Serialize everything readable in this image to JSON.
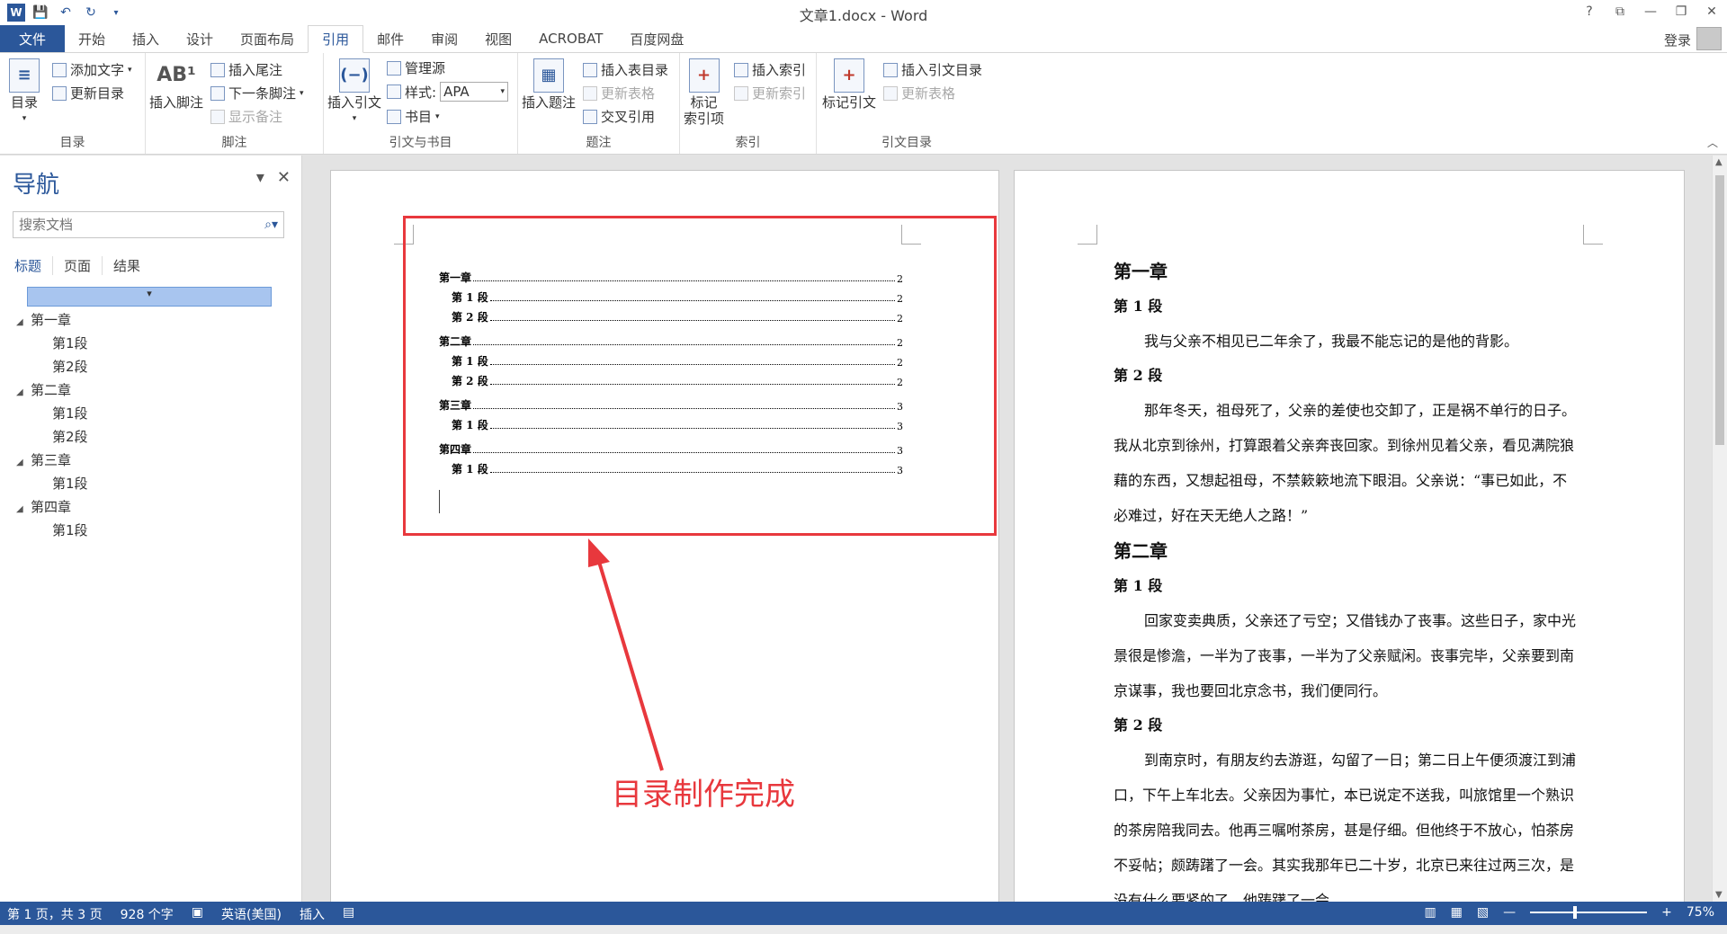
{
  "titlebar": {
    "title": "文章1.docx - Word",
    "help": "?",
    "restore": "⧉",
    "minimize": "—",
    "maximize": "❐",
    "close": "✕"
  },
  "tabs": {
    "file": "文件",
    "items": [
      "开始",
      "插入",
      "设计",
      "页面布局",
      "引用",
      "邮件",
      "审阅",
      "视图",
      "ACROBAT",
      "百度网盘"
    ],
    "active": "引用",
    "login": "登录"
  },
  "ribbon": {
    "toc_group": {
      "label": "目录",
      "toc_button": "目录",
      "add_text": "添加文字",
      "update_toc": "更新目录"
    },
    "footnote_group": {
      "label": "脚注",
      "insert_footnote": "插入脚注",
      "insert_endnote": "插入尾注",
      "next_footnote": "下一条脚注",
      "show_notes": "显示备注"
    },
    "citation_group": {
      "label": "引文与书目",
      "insert_citation": "插入引文",
      "manage_sources": "管理源",
      "style_label": "样式:",
      "style_value": "APA",
      "bibliography": "书目"
    },
    "caption_group": {
      "label": "题注",
      "insert_caption": "插入题注",
      "insert_table_of_figures": "插入表目录",
      "update_table": "更新表格",
      "cross_reference": "交叉引用"
    },
    "index_group": {
      "label": "索引",
      "mark_entry": "标记\n索引项",
      "insert_index": "插入索引",
      "update_index": "更新索引"
    },
    "authorities_group": {
      "label": "引文目录",
      "mark_citation": "标记引文",
      "insert_table_of_authorities": "插入引文目录",
      "update_table": "更新表格"
    }
  },
  "nav": {
    "title": "导航",
    "search_placeholder": "搜索文档",
    "tabs": [
      "标题",
      "页面",
      "结果"
    ],
    "tree": [
      {
        "heading": "第一章",
        "subs": [
          "第1段",
          "第2段"
        ]
      },
      {
        "heading": "第二章",
        "subs": [
          "第1段",
          "第2段"
        ]
      },
      {
        "heading": "第三章",
        "subs": [
          "第1段"
        ]
      },
      {
        "heading": "第四章",
        "subs": [
          "第1段"
        ]
      }
    ]
  },
  "toc": [
    {
      "text": "第一章",
      "page": "2",
      "level": 1
    },
    {
      "text": "第 1 段",
      "page": "2",
      "level": 2
    },
    {
      "text": "第 2 段",
      "page": "2",
      "level": 2
    },
    {
      "text": "第二章",
      "page": "2",
      "level": 1
    },
    {
      "text": "第 1 段",
      "page": "2",
      "level": 2
    },
    {
      "text": "第 2 段",
      "page": "2",
      "level": 2
    },
    {
      "text": "第三章",
      "page": "3",
      "level": 1
    },
    {
      "text": "第 1 段",
      "page": "3",
      "level": 2
    },
    {
      "text": "第四章",
      "page": "3",
      "level": 1
    },
    {
      "text": "第 1 段",
      "page": "3",
      "level": 2
    }
  ],
  "annotation": "目录制作完成",
  "page2": [
    {
      "type": "h1",
      "text": "第一章"
    },
    {
      "type": "h2",
      "text": "第 1 段"
    },
    {
      "type": "p",
      "text": "我与父亲不相见已二年余了，我最不能忘记的是他的背影。"
    },
    {
      "type": "h2",
      "text": "第 2 段"
    },
    {
      "type": "p",
      "text": "那年冬天，祖母死了，父亲的差使也交卸了，正是祸不单行的日子。我从北京到徐州，打算跟着父亲奔丧回家。到徐州见着父亲，看见满院狼藉的东西，又想起祖母，不禁簌簌地流下眼泪。父亲说：“事已如此，不必难过，好在天无绝人之路！”"
    },
    {
      "type": "h1",
      "text": "第二章"
    },
    {
      "type": "h2",
      "text": "第 1 段"
    },
    {
      "type": "p",
      "text": "回家变卖典质，父亲还了亏空；又借钱办了丧事。这些日子，家中光景很是惨澹，一半为了丧事，一半为了父亲赋闲。丧事完毕，父亲要到南京谋事，我也要回北京念书，我们便同行。"
    },
    {
      "type": "h2",
      "text": "第 2 段"
    },
    {
      "type": "p",
      "text": "到南京时，有朋友约去游逛，勾留了一日；第二日上午便须渡江到浦口，下午上车北去。父亲因为事忙，本已说定不送我，叫旅馆里一个熟识的茶房陪我同去。他再三嘱咐茶房，甚是仔细。但他终于不放心，怕茶房不妥帖；颇踌躇了一会。其实我那年已二十岁，北京已来往过两三次，是没有什么要紧的了。他踌躇了一会，"
    }
  ],
  "status": {
    "page": "第 1 页，共 3 页",
    "words": "928 个字",
    "language": "英语(美国)",
    "mode": "插入",
    "zoom": "75%",
    "zoom_fraction": 0.75
  },
  "colors": {
    "accent": "#2b579a",
    "annotation_red": "#e8383d"
  }
}
